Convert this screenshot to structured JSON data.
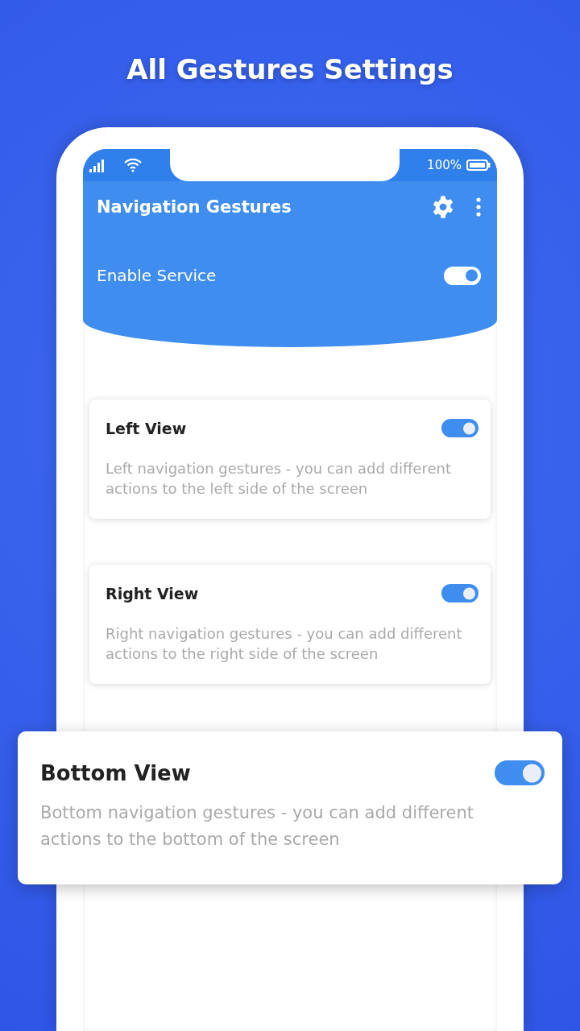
{
  "page_title": "All Gestures Settings",
  "status_bar": {
    "battery": "100%"
  },
  "app_bar": {
    "title": "Navigation Gestures"
  },
  "enable_service": {
    "label": "Enable Service",
    "on": true
  },
  "views": [
    {
      "kind": "card",
      "title": "Left View",
      "description": "Left navigation gestures - you can add different actions  to the left side of the screen",
      "on": true
    },
    {
      "kind": "card",
      "title": "Right View",
      "description": "Right navigation gestures - you can add different actions  to the right side of the screen",
      "on": true
    },
    {
      "kind": "popout",
      "title": "Bottom View",
      "description": "Bottom navigation gestures - you can add different actions to the bottom of the screen",
      "on": true
    }
  ]
}
